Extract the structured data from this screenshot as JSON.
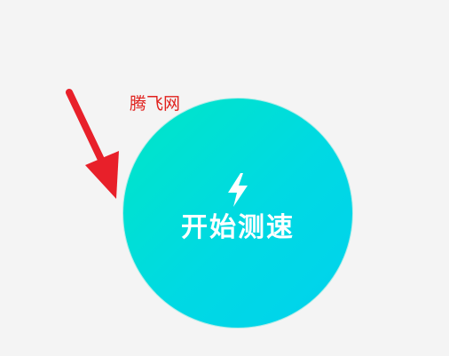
{
  "watermark": {
    "text": "腾飞网",
    "color": "#e0201c"
  },
  "annotation": {
    "icon": "red-arrow-icon",
    "color": "#e8202a"
  },
  "speed_test_button": {
    "label": "开始测速",
    "icon": "lightning-bolt-icon",
    "gradient_start": "#00e6c6",
    "gradient_end": "#00d2ee"
  }
}
